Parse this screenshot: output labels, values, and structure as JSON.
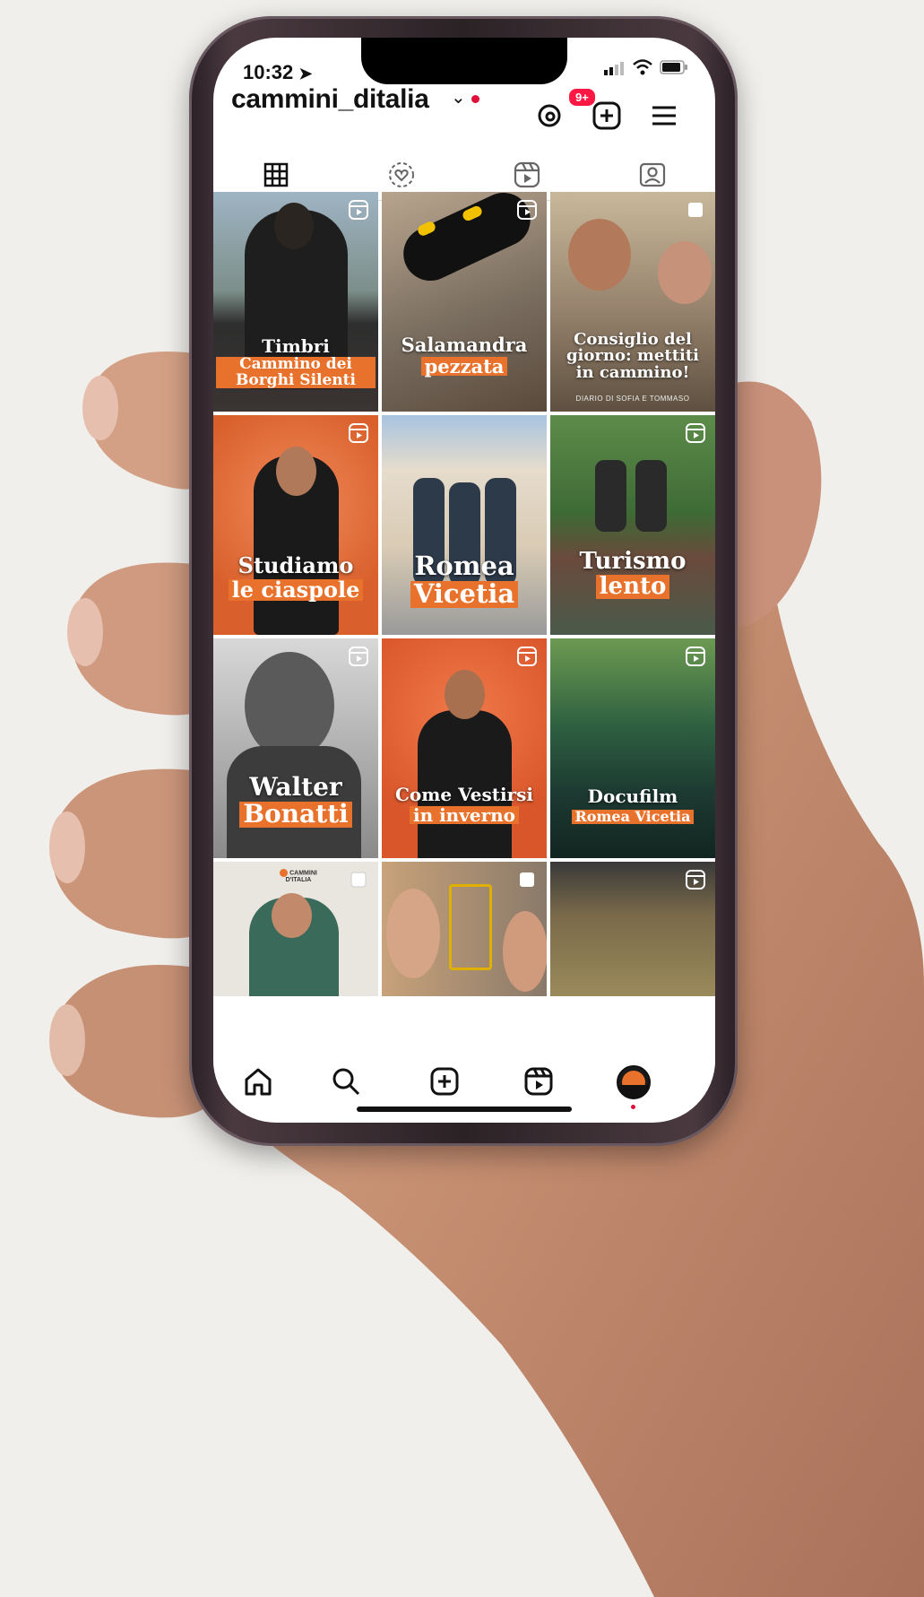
{
  "status": {
    "time": "10:32"
  },
  "profile": {
    "username": "cammini_ditalia",
    "threads_badge": "9+"
  },
  "tabs": [
    {
      "name": "posts-grid",
      "icon": "grid-icon",
      "active": true
    },
    {
      "name": "tagged-collab",
      "icon": "heart-circle-icon",
      "active": false
    },
    {
      "name": "reels",
      "icon": "reels-icon",
      "active": false
    },
    {
      "name": "tagged",
      "icon": "person-tag-icon",
      "active": false
    }
  ],
  "posts": [
    {
      "line1": "Timbri",
      "line2": "Cammino dei Borghi Silenti",
      "icon": "reels-icon"
    },
    {
      "line1": "Salamandra",
      "line2": "pezzata",
      "icon": "reels-icon"
    },
    {
      "line1": "Consiglio del giorno: mettiti in cammino!",
      "line2": "",
      "credit": "DIARIO DI SOFIA E TOMMASO",
      "icon": "carousel-icon"
    },
    {
      "line1": "Studiamo",
      "line2": "le ciaspole",
      "icon": "reels-icon"
    },
    {
      "line1": "Romea",
      "line2": "Vicetia",
      "icon": ""
    },
    {
      "line1": "Turismo",
      "line2": "lento",
      "icon": "reels-icon"
    },
    {
      "line1": "Walter",
      "line2": "Bonatti",
      "icon": "reels-icon"
    },
    {
      "line1": "Come Vestirsi",
      "line2": "in inverno",
      "icon": "reels-icon"
    },
    {
      "line1": "Docufilm",
      "line2": "Romea Vicetia",
      "icon": "reels-icon"
    },
    {
      "line1": "",
      "line2": "",
      "logo": "CAMMINI D'ITALIA",
      "icon": "carousel-icon"
    },
    {
      "line1": "",
      "line2": "",
      "icon": "carousel-icon"
    },
    {
      "line1": "",
      "line2": "",
      "icon": "reels-icon"
    }
  ],
  "nav": [
    "home-icon",
    "search-icon",
    "create-icon",
    "reels-icon",
    "profile-avatar"
  ],
  "colors": {
    "accent": "#e8722b",
    "badge": "#ff1744"
  }
}
